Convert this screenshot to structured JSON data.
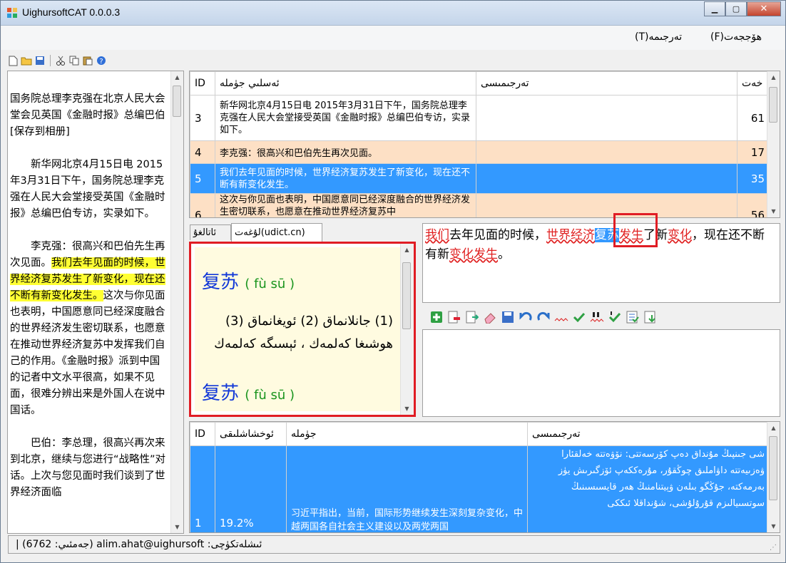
{
  "window": {
    "title": "UighursoftCAT 0.0.0.3",
    "min": "▁",
    "max": "▢",
    "close": "✕"
  },
  "menu": {
    "items": [
      {
        "label": "هۆججەت(F)"
      },
      {
        "label": "تەرجىمە(T)"
      }
    ]
  },
  "left_text": {
    "p1": "国务院总理李克强在北京人民大会堂会见英国《金融时报》总编巴伯　[保存到相册]",
    "p2": "　　新华网北京4月15日电 2015年3月31日下午，国务院总理李克强在人民大会堂接受英国《金融时报》总编巴伯专访，实录如下。",
    "p3_pre": "　　李克强：很高兴和巴伯先生再次见面。",
    "p3_hl": "我们去年见面的时候，世界经济复苏发生了新变化，现在还不断有新变化发生。",
    "p3_post": "这次与你见面也表明，中国愿意同已经深度融合的世界经济发生密切联系，也愿意在推动世界经济复苏中发挥我们自己的作用。《金融时报》派到中国的记者中文水平很高，如果不见面，很难分辨出来是外国人在说中国话。",
    "p4": "　　巴伯：李总理，很高兴再次来到北京，继续与您进行“战略性”对话。上次与您见面时我们谈到了世界经济面临"
  },
  "top_grid": {
    "headers": {
      "id": "ID",
      "source": "ئەسلىي جۈملە",
      "target": "تەرجىمىسى",
      "count": "خەت"
    },
    "rows": [
      {
        "id": "3",
        "source": "新华网北京4月15日电 2015年3月31日下午，国务院总理李克强在人民大会堂接受英国《金融时报》总编巴伯专访，实录如下。",
        "target": "",
        "count": "61"
      },
      {
        "id": "4",
        "source": "李克强：很高兴和巴伯先生再次见面。",
        "target": "",
        "count": "17"
      },
      {
        "id": "5",
        "source": "我们去年见面的时候，世界经济复苏发生了新变化，现在还不断有新变化发生。",
        "target": "",
        "count": "35"
      },
      {
        "id": "6",
        "source": "这次与你见面也表明，中国愿意同已经深度融合的世界经济发生密切联系，也愿意在推动世界经济复苏中",
        "target": "",
        "count": "56"
      }
    ]
  },
  "dict": {
    "tabs": {
      "tab1": "لۇغەت(udict.cn)",
      "tab2": "ئاتالغۇ"
    },
    "word": "复苏",
    "pinyin": "( fù sū )",
    "definition": "(1) جانلانماق (2) ئويغانماق (3) ھوشىغا كەلمەك ، ئېسىگە كەلمەك",
    "word2": "复苏",
    "pinyin2": "( fù sū )"
  },
  "source_editor": {
    "s1": "我们",
    "s2": "去年见面的时候，",
    "s3": "世界经济",
    "s4": "复苏",
    "s5": "发生",
    "s6": "了新",
    "s7": "变化",
    "s8": "，现在还不断有新",
    "s9": "变化发生",
    "s10": "。"
  },
  "bottom_grid": {
    "headers": {
      "id": "ID",
      "similarity": "ئوخشاشلىقى",
      "sentence": "جۈملە",
      "translation": "تەرجىمىسى"
    },
    "rows": [
      {
        "id": "1",
        "similarity": "19.2%",
        "sentence": "习近平指出，当前，国际形势继续发生深刻复杂变化，中越两国各自社会主义建设以及两党两国",
        "translation": "شى جىنپىڭ مۇنداق دەپ كۆرسەتتى: نۆۋەتتە خەلقئارا ۋەزىيەتتە داۋاملىق چوڭقۇر، مۇرەككەپ ئۆزگىرىش يۈز بەرمەكتە، جۇڭگو بىلەن ۋېيتنامنىڭ ھەر قايسىسىنىڭ سوتسىيالىزم قۇرۇلۇشى، شۇنداقلا ئىككى"
      }
    ]
  },
  "status": {
    "text": "| (6762 :جەمئىي) alim.ahat@uighursoft :ئىشلەتكۈچى"
  }
}
